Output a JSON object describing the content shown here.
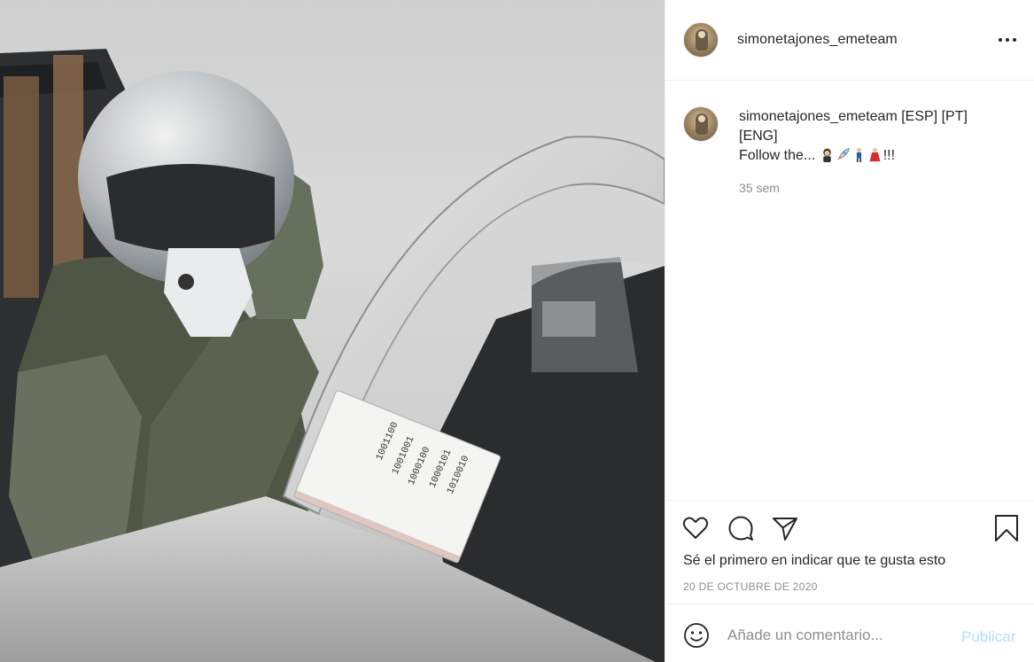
{
  "photo": {
    "notebook_lines": [
      "1001100",
      "1001001",
      "1000100",
      "1000101",
      "1010010"
    ]
  },
  "header": {
    "username": "simonetajones_emeteam",
    "more_icon": "more-horizontal-icon"
  },
  "caption": {
    "username": "simonetajones_emeteam",
    "text_line1": " [ESP] [PT] [ENG]",
    "text_line2": "Follow the...",
    "emojis": [
      "woman-pilot-emoji",
      "rocket-emoji",
      "man-dancing-emoji",
      "woman-dancing-emoji"
    ],
    "suffix": "!!!",
    "time": "35 sem"
  },
  "actions": {
    "icons": [
      "heart-icon",
      "comment-icon",
      "share-icon",
      "bookmark-icon"
    ],
    "likes_prefix": "Sé el primero en ",
    "likes_bold": "indicar que te gusta esto",
    "date": "20 DE OCTUBRE DE 2020"
  },
  "comment_box": {
    "placeholder": "Añade un comentario...",
    "publish": "Publicar"
  },
  "colors": {
    "text": "#262626",
    "muted": "#8e8e8e",
    "publish_disabled": "#b2dffc",
    "border": "#efefef"
  }
}
